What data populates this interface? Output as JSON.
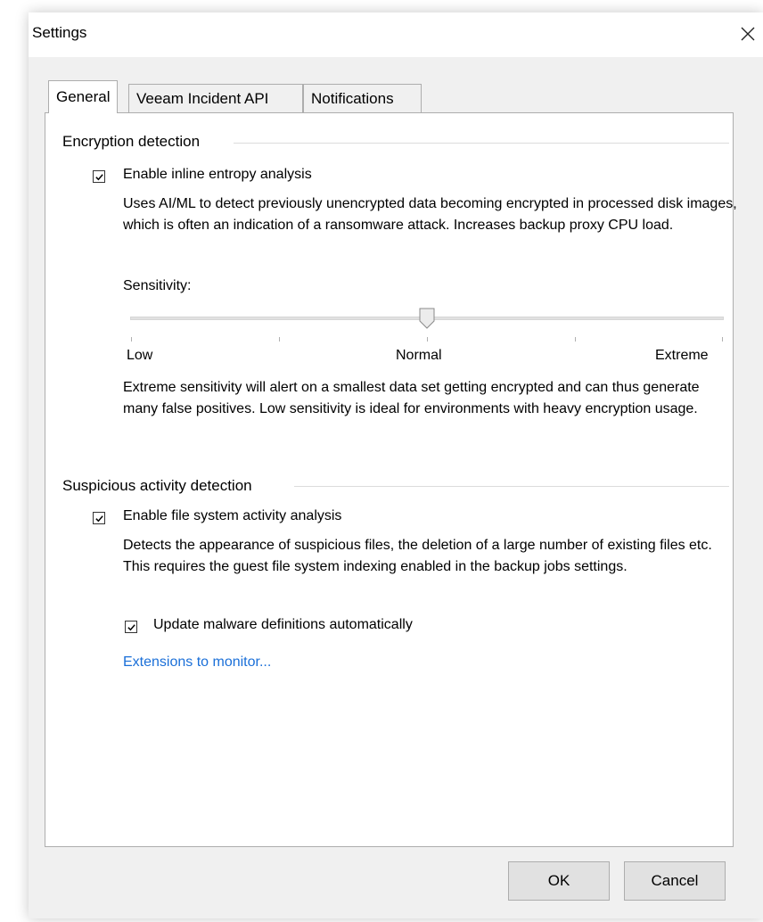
{
  "window": {
    "title": "Settings",
    "close_icon": "close-icon"
  },
  "tabs": [
    {
      "label": "General",
      "active": true
    },
    {
      "label": "Veeam Incident API",
      "active": false
    },
    {
      "label": "Notifications",
      "active": false
    }
  ],
  "encryption": {
    "group_title": "Encryption detection",
    "checkbox_label": "Enable inline entropy analysis",
    "checkbox_checked": true,
    "description": "Uses AI/ML to detect previously unencrypted data becoming encrypted in processed disk images, which is often an indication of a ransomware attack. Increases backup proxy CPU load.",
    "sensitivity_label": "Sensitivity:",
    "sensitivity_value": "Normal",
    "sensitivity_levels": [
      "Low",
      "Normal",
      "Extreme"
    ],
    "sensitivity_note": "Extreme sensitivity will alert on a smallest data set getting encrypted and can thus generate many false positives. Low sensitivity is ideal for environments with heavy encryption usage."
  },
  "suspicious": {
    "group_title": "Suspicious activity detection",
    "checkbox_label": "Enable file system activity analysis",
    "checkbox_checked": true,
    "description": "Detects the appearance of suspicious files, the deletion of a large number of existing files etc. This requires the guest file system indexing enabled in the backup jobs settings.",
    "update_label": "Update malware definitions automatically",
    "update_checked": true,
    "extensions_link": "Extensions to monitor..."
  },
  "buttons": {
    "ok": "OK",
    "cancel": "Cancel"
  },
  "colors": {
    "link": "#1a6fd8",
    "dialog_bg": "#f0f0f0",
    "panel_bg": "#ffffff"
  }
}
